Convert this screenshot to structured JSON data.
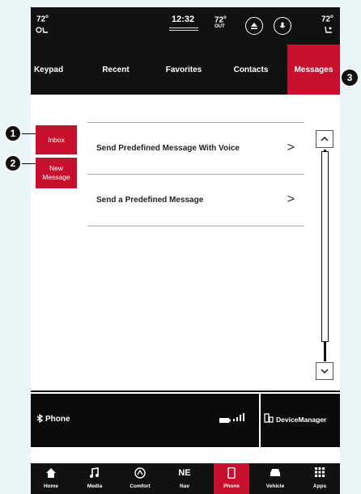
{
  "status_bar": {
    "driver_temp": "72",
    "clock": "12:32",
    "outside_temp": "72",
    "outside_label": "OUT",
    "passenger_temp": "72",
    "icons": [
      "heated-seat-icon",
      "eject-icon",
      "mic-icon",
      "passenger-seat-icon"
    ]
  },
  "tabs": [
    {
      "label": "Keypad"
    },
    {
      "label": "Recent"
    },
    {
      "label": "Favorites"
    },
    {
      "label": "Contacts"
    },
    {
      "label": "Messages"
    }
  ],
  "active_tab": "Messages",
  "side_buttons": {
    "inbox": "Inbox",
    "new_message_line1": "New",
    "new_message_line2": "Message"
  },
  "menu": [
    {
      "label": "Send Predefined Message With Voice"
    },
    {
      "label": "Send a Predefined Message"
    }
  ],
  "phone_bar": {
    "phone_label": "Phone",
    "device_manager_label": "DeviceManager"
  },
  "nav": [
    {
      "label": "Home",
      "icon": "home-icon"
    },
    {
      "label": "Media",
      "icon": "music-note-icon"
    },
    {
      "label": "Comfort",
      "icon": "comfort-icon"
    },
    {
      "label": "Nav",
      "icon": "compass-icon",
      "glyph": "NE"
    },
    {
      "label": "Phone",
      "icon": "phone-icon"
    },
    {
      "label": "Vehicle",
      "icon": "car-icon"
    },
    {
      "label": "Apps",
      "icon": "apps-grid-icon"
    }
  ],
  "active_nav": "Phone",
  "callouts": [
    "1",
    "2",
    "3"
  ],
  "colors": {
    "accent": "#c8102e",
    "bar_background": "#111111",
    "page_background": "#eaf5f8"
  }
}
